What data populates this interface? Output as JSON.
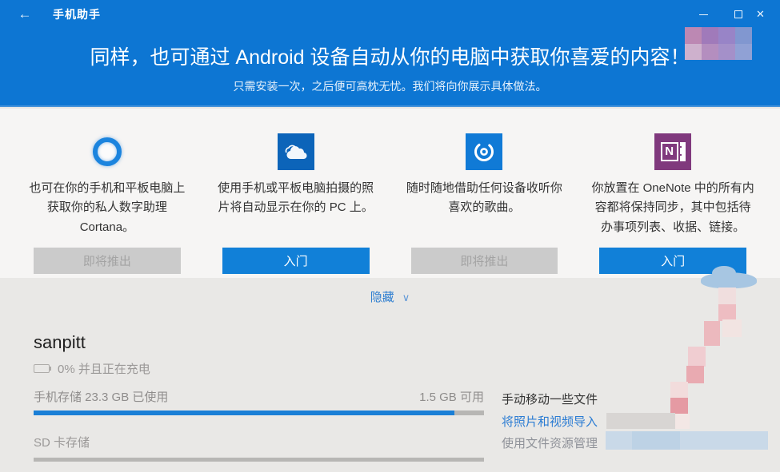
{
  "titlebar": {
    "back_glyph": "←",
    "title": "手机助手",
    "close_glyph": "✕"
  },
  "hero": {
    "heading": "同样，也可通过 Android 设备自动从你的电脑中获取你喜爱的内容！",
    "subheading": "只需安装一次，之后便可高枕无忧。我们将向你展示具体做法。"
  },
  "features": [
    {
      "icon": "cortana-ring-icon",
      "text": "也可在你的手机和平板电脑上获取你的私人数字助理 Cortana。",
      "button": "即将推出",
      "enabled": false
    },
    {
      "icon": "onedrive-cloud-icon",
      "text": "使用手机或平板电脑拍摄的照片将自动显示在你的 PC 上。",
      "button": "入门",
      "enabled": true
    },
    {
      "icon": "groove-music-icon",
      "text": "随时随地借助任何设备收听你喜欢的歌曲。",
      "button": "即将推出",
      "enabled": false
    },
    {
      "icon": "onenote-icon",
      "text": "你放置在 OneNote 中的所有内容都将保持同步，其中包括待办事项列表、收据、链接。",
      "button": "入门",
      "enabled": true,
      "onenote_letter": "N"
    }
  ],
  "hide": {
    "label": "隐藏",
    "chevron": "∨"
  },
  "device": {
    "name": "sanpitt",
    "battery_status": "0% 并且正在充电"
  },
  "storage": {
    "phone": {
      "label": "手机存储 23.3 GB 已使用",
      "available": "1.5 GB 可用",
      "percent_used": 93.5
    },
    "sd": {
      "label": "SD 卡存储"
    }
  },
  "manual_section": {
    "heading": "手动移动一些文件",
    "links": [
      {
        "label": "将照片和视频导入"
      },
      {
        "label": "使用文件资源管理"
      }
    ]
  },
  "colors": {
    "header_blue": "#0d76d3",
    "button_blue": "#1180d8",
    "progress_blue": "#1a7fd6",
    "link_blue": "#2b7cd3",
    "onenote_purple": "#80397d",
    "onedrive_blue": "#0c64b9"
  }
}
